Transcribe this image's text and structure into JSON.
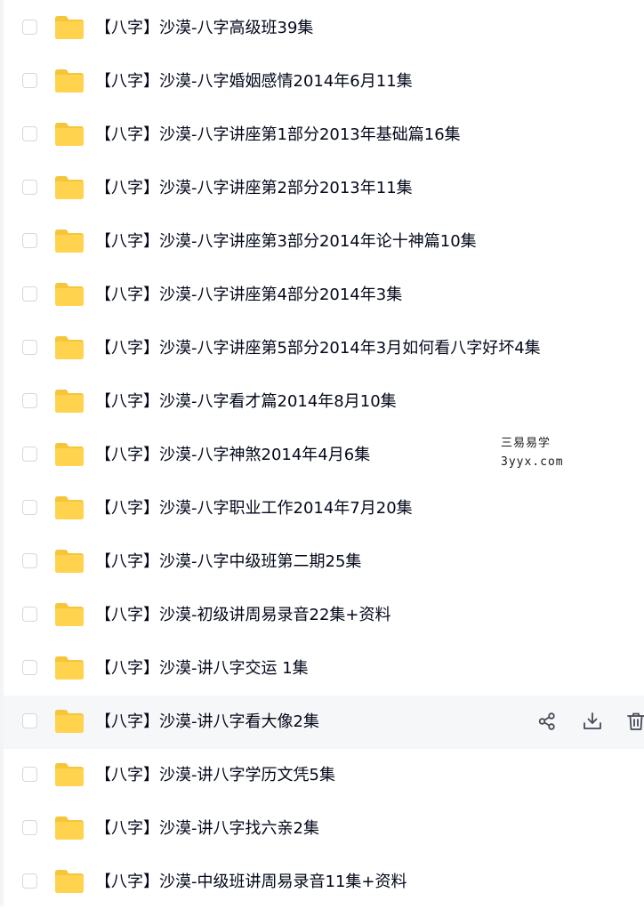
{
  "watermark": {
    "line1": "三易易学",
    "line2": "3yyx.com"
  },
  "colors": {
    "folder": "#FFD34D",
    "folder_tab": "#F5C53A",
    "text": "#03081A",
    "icon": "#444A57",
    "hover_row": "#F6F7F9"
  },
  "files": [
    {
      "name": "【八字】沙漠-八字高级班39集"
    },
    {
      "name": "【八字】沙漠-八字婚姻感情2014年6月11集"
    },
    {
      "name": "【八字】沙漠-八字讲座第1部分2013年基础篇16集"
    },
    {
      "name": "【八字】沙漠-八字讲座第2部分2013年11集"
    },
    {
      "name": "【八字】沙漠-八字讲座第3部分2014年论十神篇10集"
    },
    {
      "name": "【八字】沙漠-八字讲座第4部分2014年3集"
    },
    {
      "name": "【八字】沙漠-八字讲座第5部分2014年3月如何看八字好坏4集"
    },
    {
      "name": "【八字】沙漠-八字看才篇2014年8月10集"
    },
    {
      "name": "【八字】沙漠-八字神煞2014年4月6集"
    },
    {
      "name": "【八字】沙漠-八字职业工作2014年7月20集"
    },
    {
      "name": "【八字】沙漠-八字中级班第二期25集"
    },
    {
      "name": "【八字】沙漠-初级讲周易录音22集+资料"
    },
    {
      "name": "【八字】沙漠-讲八字交运 1集"
    },
    {
      "name": "【八字】沙漠-讲八字看大像2集"
    },
    {
      "name": "【八字】沙漠-讲八字学历文凭5集"
    },
    {
      "name": "【八字】沙漠-讲八字找六亲2集"
    },
    {
      "name": "【八字】沙漠-中级班讲周易录音11集+资料"
    }
  ],
  "hover_index": 13,
  "hover_actions": [
    {
      "icon": "share-icon"
    },
    {
      "icon": "download-icon"
    },
    {
      "icon": "trash-icon"
    }
  ]
}
